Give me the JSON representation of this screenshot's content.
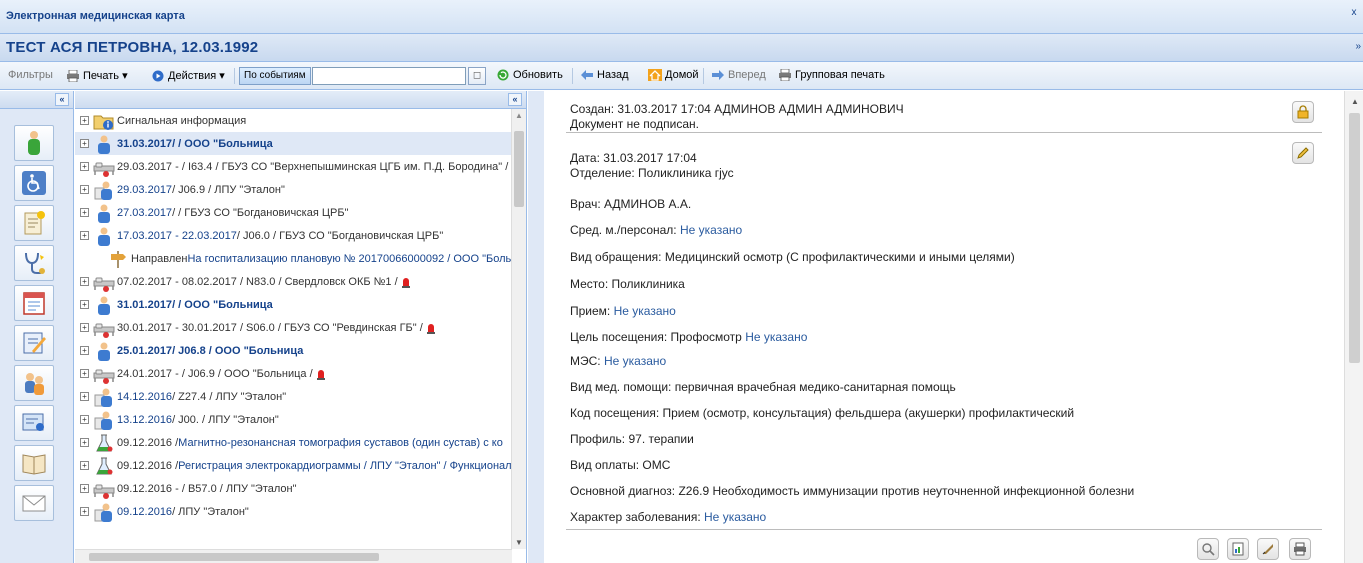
{
  "window": {
    "title": "Электронная медицинская карта",
    "close_glyph": "x"
  },
  "patient": {
    "name": "ТЕСТ АСЯ ПЕТРОВНА, 12.03.1992",
    "collapse_glyph": "»"
  },
  "toolbar": {
    "filters": "Фильтры",
    "print": "Печать ▾",
    "actions": "Действия ▾",
    "events_button": "По событиям",
    "search_value": "",
    "calendar_glyph": "◻",
    "refresh": "Обновить",
    "back": "Назад",
    "home": "Домой",
    "forward": "Вперед",
    "group_print": "Групповая печать"
  },
  "panels": {
    "left_collapse": "«",
    "tree_collapse": "«"
  },
  "tree": {
    "rows": [
      {
        "date": "",
        "text": "Сигнальная информация",
        "icon": "folder-info",
        "bold": false,
        "flag": false
      },
      {
        "date": "31.03.2017",
        "text": " /  / ООО \"Больница",
        "icon": "doctor",
        "bold": true,
        "flag": false,
        "selected": true
      },
      {
        "date": "",
        "text": "29.03.2017 - / I63.4 / ГБУЗ СО \"Верхнепышминская ЦГБ им. П.Д. Бородина\" /",
        "icon": "bed",
        "bold": false,
        "flag": false
      },
      {
        "date": "29.03.2017",
        "text": " /  J06.9  / ЛПУ \"Эталон\"",
        "icon": "doctor-file",
        "bold": false,
        "flag": false
      },
      {
        "date": "27.03.2017",
        "text": " /  / ГБУЗ СО \"Богдановичская ЦРБ\"",
        "icon": "doctor",
        "bold": false,
        "flag": false
      },
      {
        "date": "17.03.2017 - 22.03.2017",
        "text": " /  J06.0  / ГБУЗ СО \"Богдановичская ЦРБ\"",
        "icon": "doctor",
        "bold": false,
        "flag": false
      },
      {
        "date": "",
        "text": "Направлен ",
        "extra": "На госпитализацию плановую  №  20170066000092  / ООО \"Боль",
        "icon": "sign",
        "bold": false,
        "flag": false,
        "child": true
      },
      {
        "date": "",
        "text": "07.02.2017 - 08.02.2017 / N83.0 / Свердловск ОКБ №1 /",
        "icon": "bed",
        "bold": false,
        "flag": true
      },
      {
        "date": "31.01.2017",
        "text": " /  / ООО \"Больница",
        "icon": "doctor",
        "bold": true,
        "flag": false
      },
      {
        "date": "",
        "text": "30.01.2017 - 30.01.2017 / S06.0 / ГБУЗ СО \"Ревдинская ГБ\" /",
        "icon": "bed",
        "bold": false,
        "flag": true
      },
      {
        "date": "25.01.2017",
        "text": " /  J06.8  / ООО \"Больница",
        "icon": "doctor",
        "bold": true,
        "flag": false
      },
      {
        "date": "",
        "text": "24.01.2017 - / J06.9 / ООО \"Больница /",
        "icon": "bed",
        "bold": false,
        "flag": true
      },
      {
        "date": "14.12.2016",
        "text": " /  Z27.4  / ЛПУ \"Эталон\"",
        "icon": "doctor-file",
        "bold": false,
        "flag": false
      },
      {
        "date": "13.12.2016",
        "text": " /  J00.  / ЛПУ \"Эталон\"",
        "icon": "doctor-file",
        "bold": false,
        "flag": false
      },
      {
        "date": "",
        "text": "09.12.2016 / ",
        "extra": "Магнитно-резонансная томография суставов (один сустав) с ко",
        "icon": "flask",
        "bold": false,
        "flag": false
      },
      {
        "date": "",
        "text": "09.12.2016 / ",
        "extra": "Регистрация электрокардиограммы  / ЛПУ \"Эталон\" / Функционал",
        "icon": "flask",
        "bold": false,
        "flag": false
      },
      {
        "date": "",
        "text": "09.12.2016 - / B57.0 / ЛПУ \"Эталон\"",
        "icon": "bed",
        "bold": false,
        "flag": false
      },
      {
        "date": "09.12.2016",
        "text": " /  ЛПУ \"Эталон\"",
        "icon": "doctor-file",
        "bold": false,
        "flag": false
      }
    ]
  },
  "document": {
    "created": "Создан: 31.03.2017 17:04 АДМИНОВ АДМИН АДМИНОВИЧ",
    "not_signed": "Документ не подписан.",
    "date": "Дата: 31.03.2017 17:04",
    "department": "Отделение: Поликлиника гјус",
    "doctor": "Врач: АДМИНОВ А.А.",
    "staff_label": "Сред. м./персонал:",
    "staff_value": "Не указано",
    "visit_type": "Вид обращения: Медицинский осмотр (С профилактическими и иными целями)",
    "place": "Место: Поликлиника",
    "reception_label": "Прием:",
    "reception_value": "Не указано",
    "purpose_label": "Цель посещения: Профосмотр",
    "purpose_value": "Не указано",
    "mes_label": "МЭС:",
    "mes_value": "Не указано",
    "aid_type": "Вид мед. помощи: первичная врачебная медико-санитарная помощь",
    "visit_code": "Код посещения: Прием (осмотр, консультация) фельдшера (акушерки) профилактический",
    "profile": "Профиль: 97. терапии",
    "payment": "Вид оплаты: ОМС",
    "diagnosis": "Основной диагноз: Z26.9 Необходимость иммунизации против неуточненной инфекционной болезни",
    "nature_label": "Характер заболевания:",
    "nature_value": "Не указано"
  },
  "colors": {
    "header_text": "#15428b",
    "value_blue": "#2a5b9f",
    "border": "#99bbe8"
  }
}
